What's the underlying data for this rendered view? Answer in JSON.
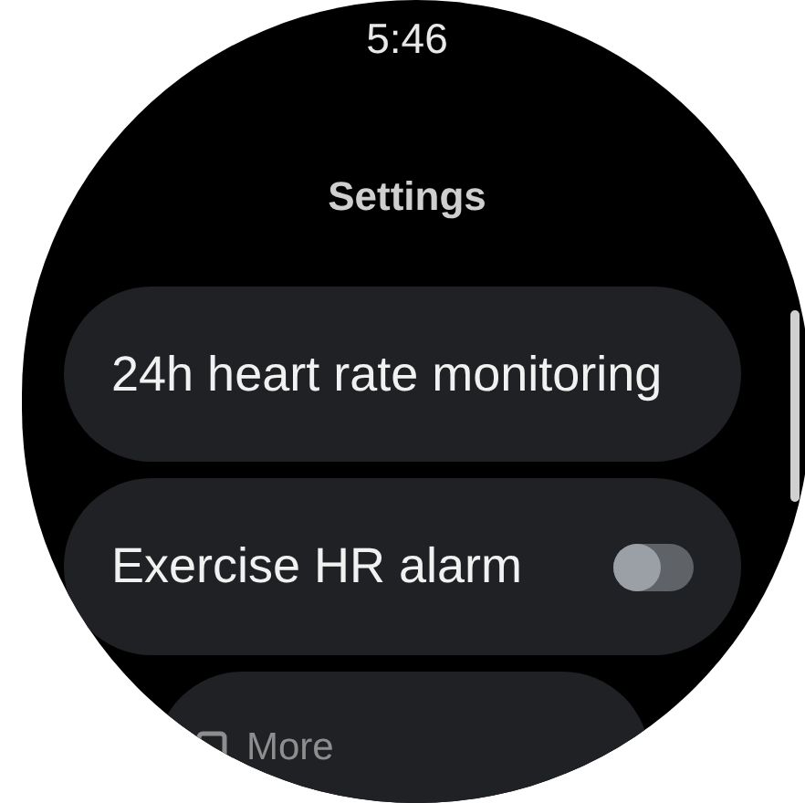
{
  "status_bar": {
    "time": "5:46"
  },
  "title": "Settings",
  "items": [
    {
      "kind": "link",
      "label": "24h heart rate monitoring"
    },
    {
      "kind": "toggle",
      "label": "Exercise HR alarm",
      "on": false
    },
    {
      "kind": "more",
      "label": "More"
    }
  ]
}
